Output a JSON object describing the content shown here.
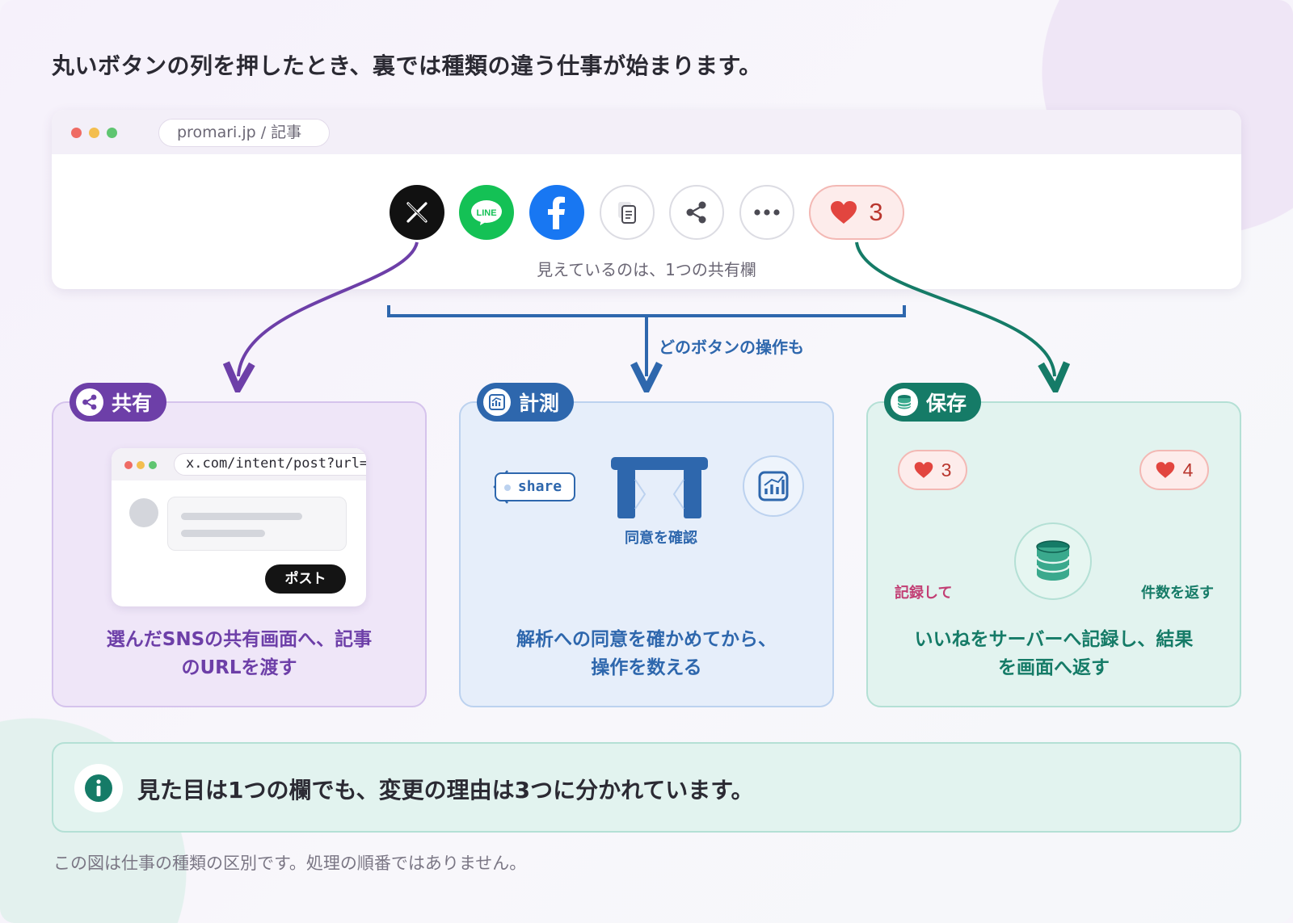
{
  "headline": "丸いボタンの列を押したとき、裏では種類の違う仕事が始まります。",
  "browser": {
    "url": "promari.jp / 記事",
    "caption": "見えているのは、1つの共有欄",
    "like_count": "3",
    "buttons": [
      {
        "name": "x-share-button",
        "icon": "x-logo-icon"
      },
      {
        "name": "line-share-button",
        "icon": "line-logo-icon",
        "label": "LINE"
      },
      {
        "name": "facebook-share-button",
        "icon": "facebook-logo-icon",
        "label": "f"
      },
      {
        "name": "copy-link-button",
        "icon": "copy-icon"
      },
      {
        "name": "share-button",
        "icon": "share-nodes-icon"
      },
      {
        "name": "more-button",
        "icon": "more-dots-icon"
      }
    ]
  },
  "bracket_label": "どのボタンの操作も",
  "cards": {
    "share": {
      "tag": "共有",
      "mini_url": "x.com/intent/post?url=…",
      "post_label": "ポスト",
      "text": [
        "選んだSNSの共有画面へ、記事",
        "のURLを渡す"
      ],
      "color": "#6d3fa8"
    },
    "measure": {
      "tag": "計測",
      "event_label": "share",
      "gate_label": "同意を確認",
      "text": [
        "解析への同意を確かめてから、",
        "操作を数える"
      ],
      "color": "#2e67ad"
    },
    "store": {
      "tag": "保存",
      "before_count": "3",
      "after_count": "4",
      "record_label": "記録して",
      "return_label": "件数を返す",
      "text": [
        "いいねをサーバーへ記録し、結果",
        "を画面へ返す"
      ],
      "color": "#157b67"
    }
  },
  "note": {
    "text": "見た目は1つの欄でも、変更の理由は3つに分かれています。",
    "icon": "info-icon"
  },
  "footnote": "この図は仕事の種類の区別です。処理の順番ではありません。"
}
